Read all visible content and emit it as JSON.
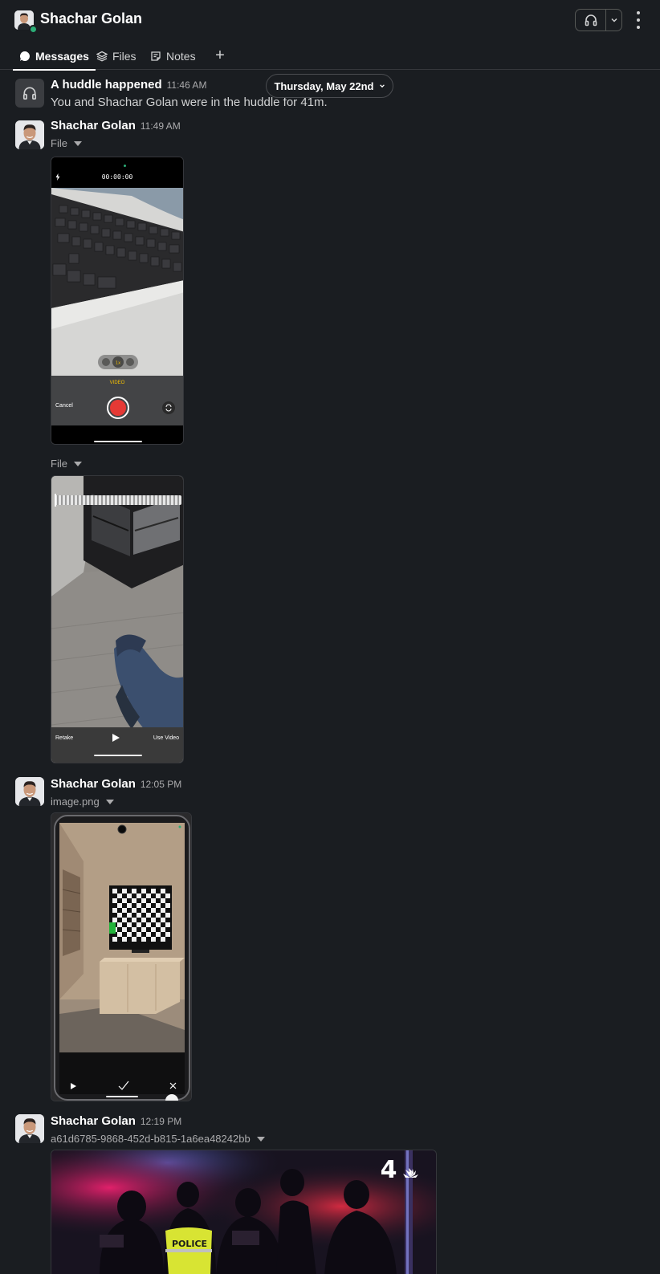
{
  "header": {
    "title": "Shachar Golan",
    "presence": "online",
    "huddle_icon": "headphones-icon",
    "menu_icon": "kebab-icon"
  },
  "tabs": [
    {
      "label": "Messages",
      "icon": "message-bubble-icon",
      "active": true
    },
    {
      "label": "Files",
      "icon": "layers-icon",
      "active": false
    },
    {
      "label": "Notes",
      "icon": "canvas-note-icon",
      "active": false
    }
  ],
  "date_divider": "Thursday, May 22nd",
  "messages": [
    {
      "sender": "A huddle happened",
      "time": "11:46 AM",
      "text": "You and Shachar Golan were in the huddle for 41m."
    },
    {
      "sender": "Shachar Golan",
      "time": "11:49 AM",
      "files": [
        {
          "label": "File",
          "timer": "00:00:00",
          "cancel": "Cancel",
          "mode": "VIDEO"
        },
        {
          "label": "File",
          "retake": "Retake",
          "use": "Use Video"
        }
      ]
    },
    {
      "sender": "Shachar Golan",
      "time": "12:05 PM",
      "files": [
        {
          "label": "image.png"
        }
      ]
    },
    {
      "sender": "Shachar Golan",
      "time": "12:19 PM",
      "files": [
        {
          "label": "a61d6785-9868-452d-b815-1a6ea48242bb",
          "overlay_text": "POLICE",
          "channel": "4"
        }
      ]
    }
  ],
  "colors": {
    "background": "#1a1d21",
    "text": "#d1d2d3",
    "muted": "#ababad",
    "presence": "#2bac76",
    "record": "#e53935"
  }
}
